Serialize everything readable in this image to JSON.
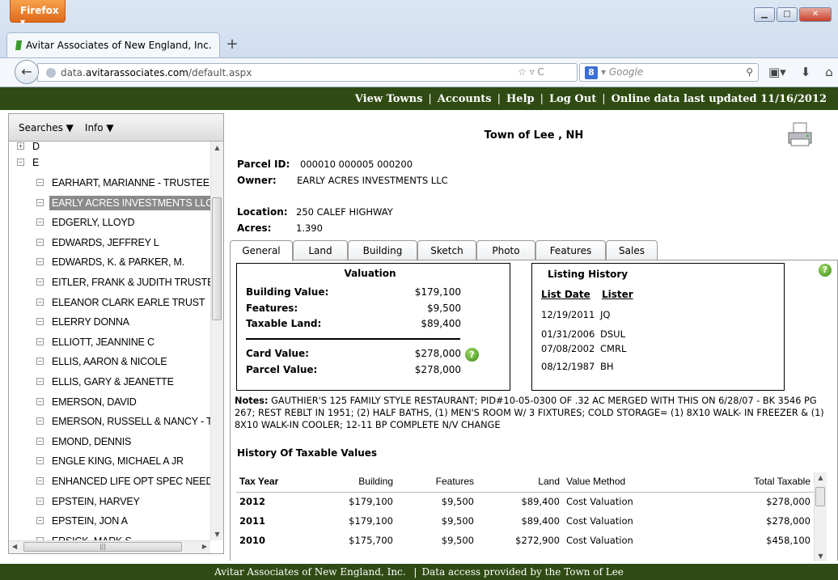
{
  "browser": {
    "menu_label": "Firefox ▾",
    "tab_title": "Avitar Associates of New England, Inc.",
    "new_tab": "+",
    "url_prefix": "data.",
    "url_domain": "avitarassociates.com",
    "url_path": "/default.aspx",
    "search_placeholder": "Google",
    "search_engine": "8"
  },
  "topnav": {
    "items": [
      "View Towns",
      "Accounts",
      "Help",
      "Log Out"
    ],
    "status": "Online data last updated 11/16/2012"
  },
  "sidebar": {
    "menu": [
      "Searches ▼",
      "Info ▼"
    ],
    "groups": [
      {
        "label": "D",
        "expanded": false
      },
      {
        "label": "E",
        "expanded": true
      }
    ],
    "items": [
      "EARHART, MARIANNE - TRUSTEE",
      "EARLY ACRES INVESTMENTS LLC",
      "EDGERLY, LLOYD",
      "EDWARDS, JEFFREY L",
      "EDWARDS, K. & PARKER, M.",
      "EITLER, FRANK & JUDITH TRUSTEE",
      "ELEANOR CLARK EARLE TRUST",
      "ELERRY DONNA",
      "ELLIOTT, JEANNINE C",
      "ELLIS, AARON & NICOLE",
      "ELLIS, GARY & JEANETTE",
      "EMERSON, DAVID",
      "EMERSON, RUSSELL & NANCY - TRU",
      "EMOND, DENNIS",
      "ENGLE KING, MICHAEL A JR",
      "ENHANCED LIFE OPT SPEC NEEDS",
      "EPSTEIN, HARVEY",
      "EPSTEIN, JON A",
      "ERSICK, MARK S"
    ],
    "selected_index": 1
  },
  "parcel": {
    "town": "Town of Lee , NH",
    "id_label": "Parcel ID:",
    "id": "000010 000005 000200",
    "owner_label": "Owner:",
    "owner": "EARLY ACRES INVESTMENTS LLC",
    "location_label": "Location:",
    "location": "250 CALEF HIGHWAY",
    "acres_label": "Acres:",
    "acres": "1.390"
  },
  "tabs": [
    "General",
    "Land",
    "Building",
    "Sketch",
    "Photo",
    "Features",
    "Sales"
  ],
  "valuation": {
    "title": "Valuation",
    "building_label": "Building Value:",
    "building": "$179,100",
    "features_label": "Features:",
    "features": "$9,500",
    "land_label": "Taxable Land:",
    "land": "$89,400",
    "card_label": "Card Value:",
    "card": "$278,000",
    "parcel_label": "Parcel Value:",
    "parcel": "$278,000"
  },
  "listing": {
    "title": "Listing History",
    "col_date": "List Date",
    "col_lister": "Lister",
    "rows": [
      {
        "date": "12/19/2011",
        "lister": "JQ"
      },
      {
        "date": "01/31/2006",
        "lister": "DSUL"
      },
      {
        "date": "07/08/2002",
        "lister": "CMRL"
      },
      {
        "date": "08/12/1987",
        "lister": "BH"
      }
    ]
  },
  "notes": {
    "label": "Notes:",
    "text": " GAUTHIER'S 125 FAMILY STYLE RESTAURANT; PID#10-05-0300 OF .32 AC MERGED WITH THIS ON 6/28/07 - BK 3546 PG 267; REST REBLT IN 1951; (2) HALF BATHS, (1) MEN'S ROOM W/ 3 FIXTURES; COLD STORAGE= (1) 8X10 WALK- IN FREEZER & (1) 8X10 WALK-IN COOLER; 12-11 BP COMPLETE N/V CHANGE"
  },
  "history": {
    "title": "History Of Taxable Values",
    "columns": [
      "Tax Year",
      "Building",
      "Features",
      "Land",
      "Value Method",
      "Total Taxable"
    ],
    "rows": [
      [
        "2012",
        "$179,100",
        "$9,500",
        "$89,400",
        "Cost Valuation",
        "$278,000"
      ],
      [
        "2011",
        "$179,100",
        "$9,500",
        "$89,400",
        "Cost Valuation",
        "$278,000"
      ],
      [
        "2010",
        "$175,700",
        "$9,500",
        "$272,900",
        "Cost Valuation",
        "$458,100"
      ]
    ]
  },
  "footer": {
    "left": "Avitar Associates of New England, Inc.",
    "right": "Data access provided by the Town of Lee"
  }
}
